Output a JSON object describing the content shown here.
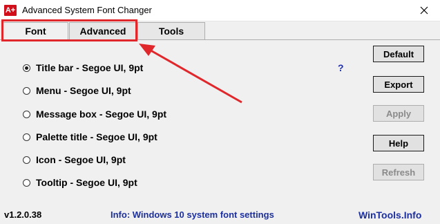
{
  "window": {
    "icon_text": "A+",
    "title": "Advanced System Font Changer"
  },
  "tabs": [
    {
      "label": "Font",
      "active": true
    },
    {
      "label": "Advanced",
      "active": false
    },
    {
      "label": "Tools",
      "active": false
    }
  ],
  "options": [
    {
      "label": "Title bar - Segoe UI, 9pt",
      "checked": true
    },
    {
      "label": "Menu - Segoe UI, 9pt",
      "checked": false
    },
    {
      "label": "Message box - Segoe UI, 9pt",
      "checked": false
    },
    {
      "label": "Palette title - Segoe UI, 9pt",
      "checked": false
    },
    {
      "label": "Icon - Segoe UI, 9pt",
      "checked": false
    },
    {
      "label": "Tooltip - Segoe UI, 9pt",
      "checked": false
    }
  ],
  "help_link": "?",
  "buttons": {
    "default": "Default",
    "export": "Export",
    "apply": "Apply",
    "help": "Help",
    "refresh": "Refresh"
  },
  "status": {
    "version": "v1.2.0.38",
    "info": "Info: Windows 10 system font settings",
    "website": "WinTools.Info"
  },
  "colors": {
    "annotation": "#e0282c",
    "link": "#1c2fa0"
  }
}
